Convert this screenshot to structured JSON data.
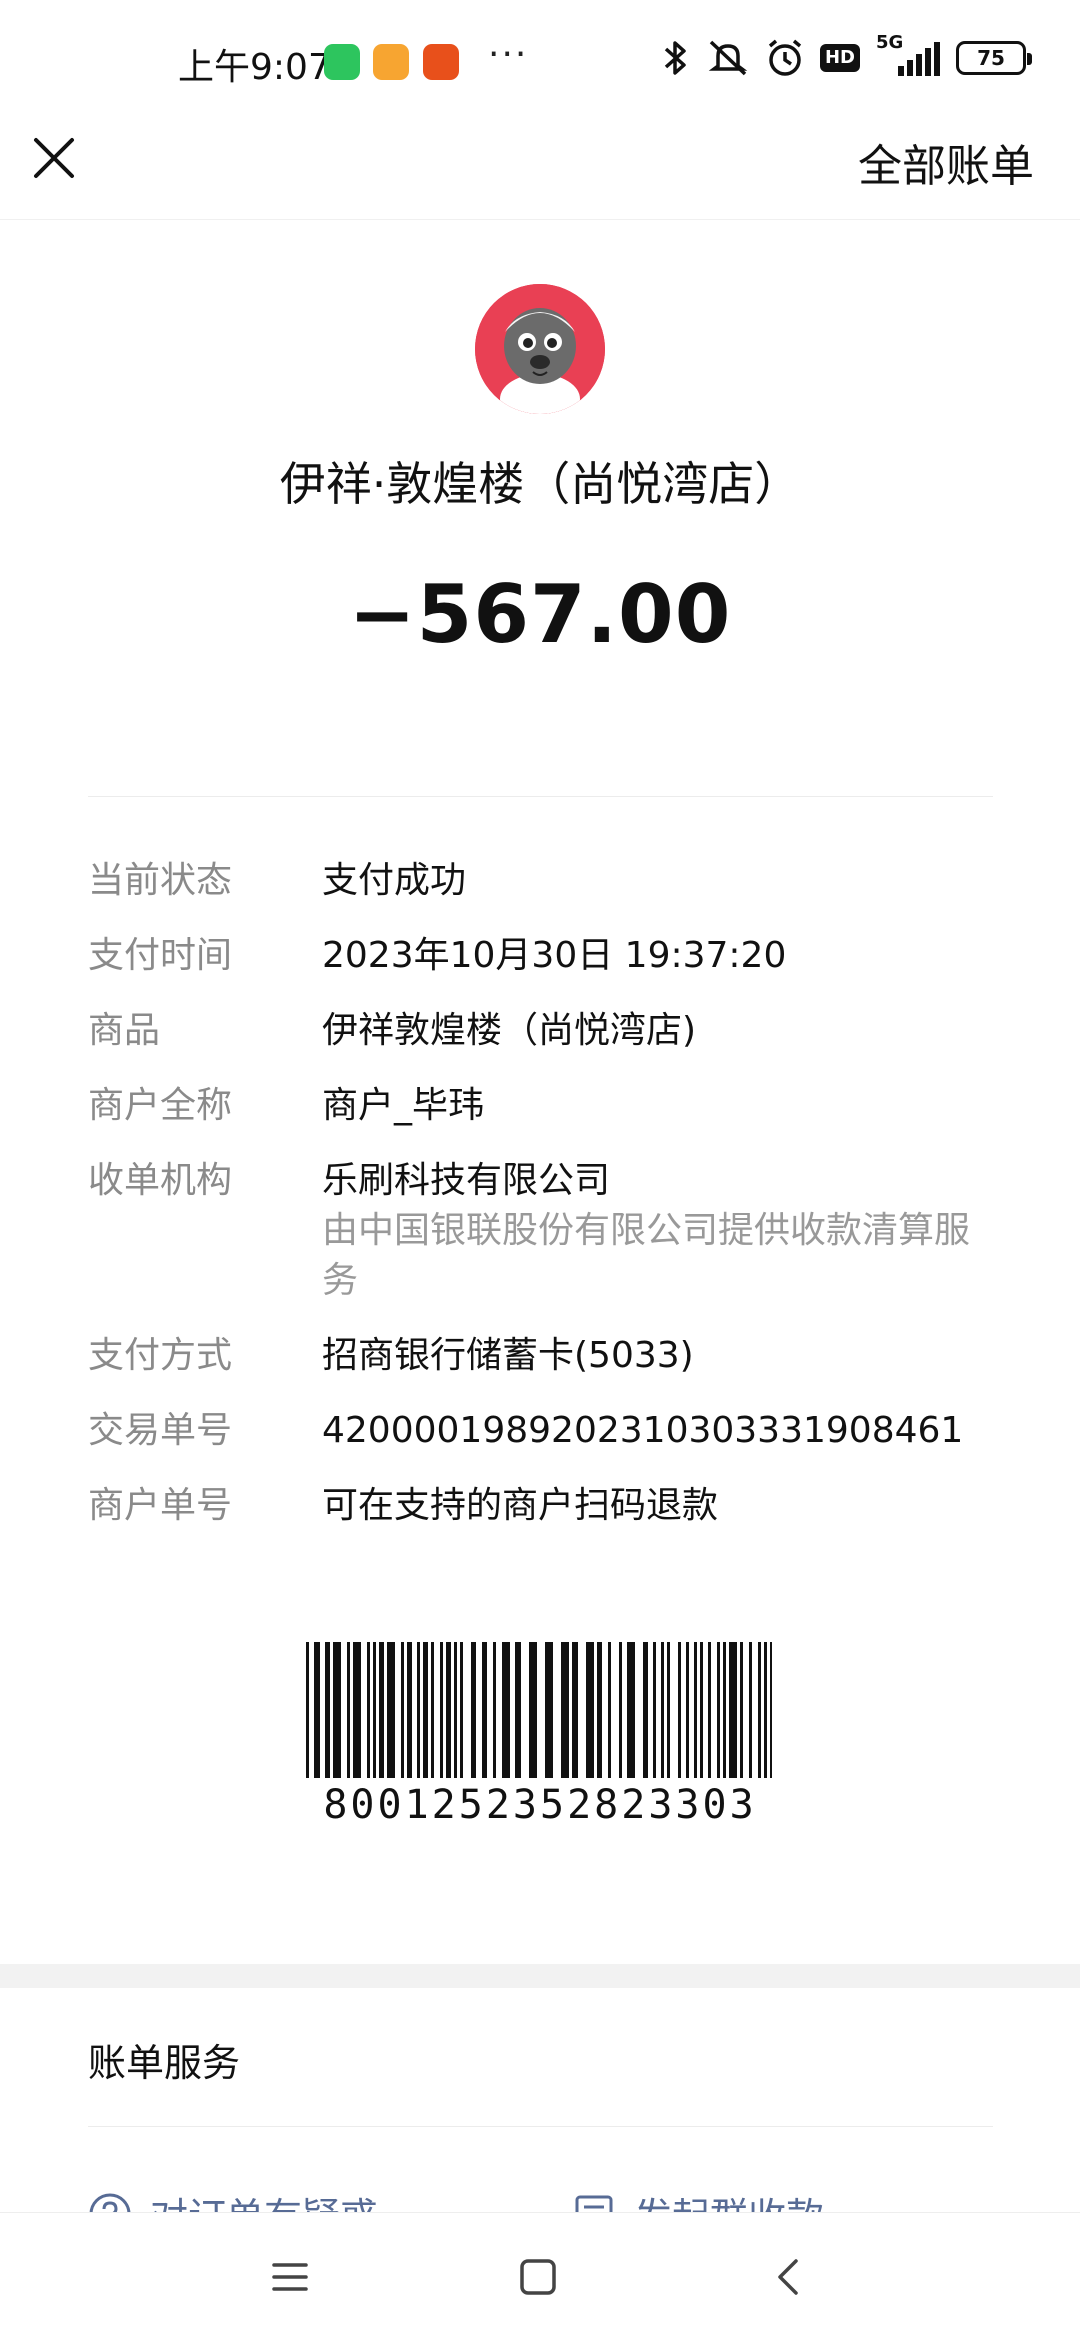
{
  "status_bar": {
    "time": "上午9:07",
    "dots": "···",
    "network": "5G",
    "battery": "75",
    "hd": "HD"
  },
  "nav": {
    "all_bills": "全部账单"
  },
  "merchant": {
    "name": "伊祥·敦煌楼（尚悦湾店）",
    "amount": "−567.00",
    "avatar_color": "#e94054"
  },
  "details": [
    {
      "label": "当前状态",
      "value": "支付成功"
    },
    {
      "label": "支付时间",
      "value": "2023年10月30日 19:37:20"
    },
    {
      "label": "商品",
      "value": "伊祥敦煌楼（尚悦湾店)"
    },
    {
      "label": "商户全称",
      "value": "商户_毕玮"
    },
    {
      "label": "收单机构",
      "value": "乐刷科技有限公司",
      "sub": "由中国银联股份有限公司提供收款清算服务"
    },
    {
      "label": "支付方式",
      "value": "招商银行储蓄卡(5033)"
    },
    {
      "label": "交易单号",
      "value": "4200001989202310303331908461"
    },
    {
      "label": "商户单号",
      "value": "可在支持的商户扫码退款"
    }
  ],
  "barcode": {
    "number": "8001252352823303"
  },
  "bill_service": {
    "title": "账单服务",
    "items": [
      {
        "label": "对订单有疑惑",
        "icon": "question-icon"
      },
      {
        "label": "发起群收款",
        "icon": "group-collect-icon"
      }
    ]
  },
  "colors": {
    "link": "#576b95",
    "label_gray": "#8a8a8a"
  }
}
